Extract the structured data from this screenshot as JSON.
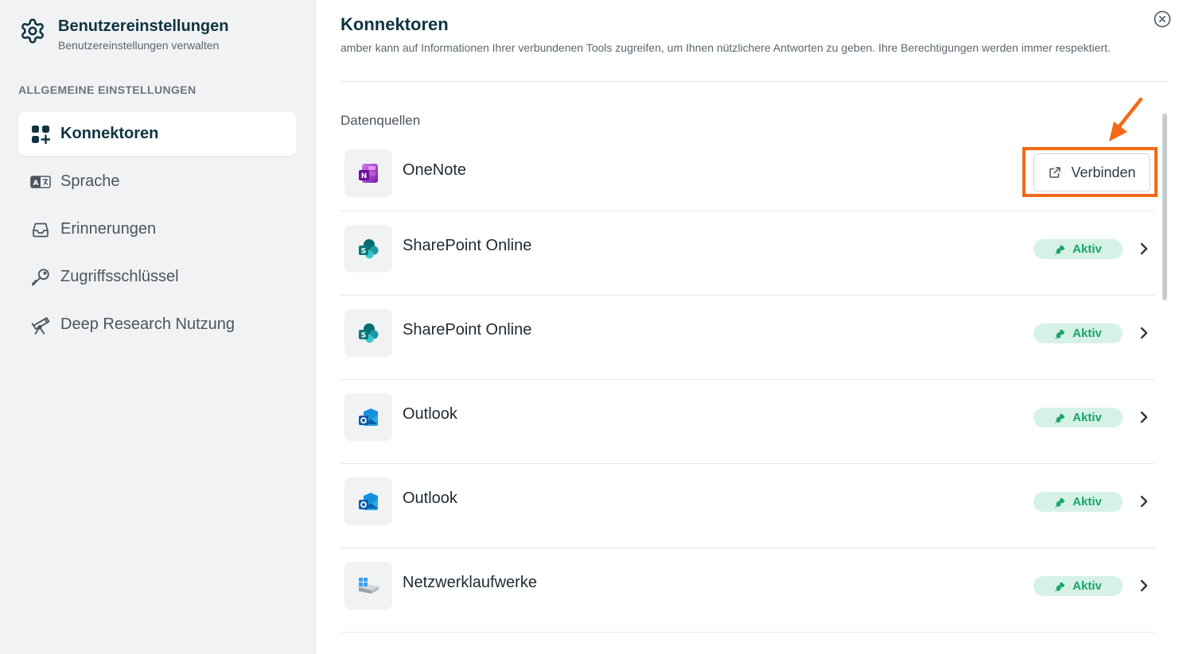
{
  "sidebar": {
    "title": "Benutzereinstellungen",
    "subtitle": "Benutzereinstellungen verwalten",
    "section": "ALLGEMEINE EINSTELLUNGEN",
    "items": [
      {
        "label": "Konnektoren",
        "icon": "connectors-grid-icon",
        "active": true
      },
      {
        "label": "Sprache",
        "icon": "language-icon",
        "active": false
      },
      {
        "label": "Erinnerungen",
        "icon": "inbox-icon",
        "active": false
      },
      {
        "label": "Zugriffsschlüssel",
        "icon": "key-icon",
        "active": false
      },
      {
        "label": "Deep Research Nutzung",
        "icon": "telescope-icon",
        "active": false
      }
    ]
  },
  "main": {
    "title": "Konnektoren",
    "description": "amber kann auf Informationen Ihrer verbundenen Tools zugreifen, um Ihnen nützlichere Antworten zu geben. Ihre Berechtigungen werden immer respektiert.",
    "section": "Datenquellen",
    "connect_label": "Verbinden",
    "status_label": "Aktiv",
    "connectors": [
      {
        "name": "OneNote",
        "icon": "onenote-icon",
        "status": "disconnected"
      },
      {
        "name": "SharePoint Online",
        "icon": "sharepoint-icon",
        "status": "active"
      },
      {
        "name": "SharePoint Online",
        "icon": "sharepoint-icon",
        "status": "active"
      },
      {
        "name": "Outlook",
        "icon": "outlook-icon",
        "status": "active"
      },
      {
        "name": "Outlook",
        "icon": "outlook-icon",
        "status": "active"
      },
      {
        "name": "Netzwerklaufwerke",
        "icon": "network-drive-icon",
        "status": "active"
      }
    ]
  },
  "colors": {
    "accent_text": "#0f3440",
    "active_badge_bg": "#d6f2e6",
    "active_badge_text": "#1ba36b",
    "highlight": "#f26a18"
  }
}
